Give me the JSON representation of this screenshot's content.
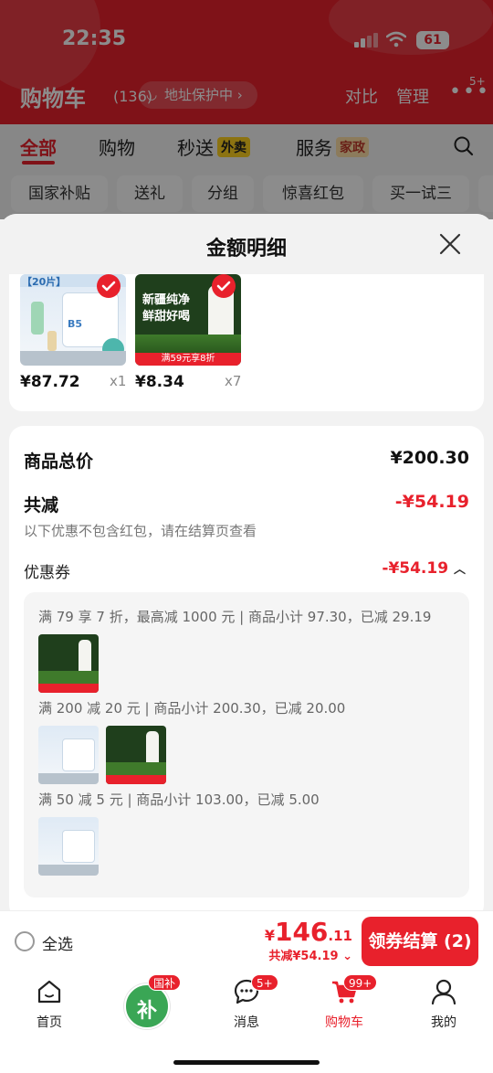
{
  "status_bar": {
    "time": "22:35",
    "battery": "61"
  },
  "cart_header": {
    "title": "购物车",
    "count": "(136)",
    "address_protect": "地址保护中",
    "compare": "对比",
    "manage": "管理",
    "more_badge": "5+"
  },
  "tabs": [
    {
      "label": "全部"
    },
    {
      "label": "购物"
    },
    {
      "label": "秒送",
      "tag": "外卖"
    },
    {
      "label": "服务",
      "tag": "家政"
    }
  ],
  "chips": [
    "国家补贴",
    "送礼",
    "分组",
    "惊喜红包",
    "买一试三"
  ],
  "sheet": {
    "title": "金额明细",
    "products": [
      {
        "price": "¥87.72",
        "qty": "x1",
        "thumb_label": "【20片】",
        "thumb_code": "B5"
      },
      {
        "price": "¥8.34",
        "qty": "x7",
        "thumb_line1": "新疆纯净",
        "thumb_line2": "鲜甜好喝",
        "thumb_promo": "满59元享8折"
      }
    ],
    "summary": {
      "total_label": "商品总价",
      "total_value": "¥200.30",
      "discount_label": "共减",
      "discount_value": "-¥54.19",
      "note": "以下优惠不包含红包，请在结算页查看",
      "coupon_label": "优惠券",
      "coupon_value": "-¥54.19"
    },
    "coupon_rules": [
      "满 79 享 7 折，最高减 1000 元 | 商品小计 97.30，已减 29.19",
      "满 200 减 20 元 | 商品小计 200.30，已减 20.00",
      "满 50 减 5 元 | 商品小计 103.00，已减 5.00"
    ]
  },
  "checkout": {
    "select_all": "全选",
    "yen": "¥",
    "total_int": "146",
    "total_dec": ".11",
    "saved": "共减¥54.19",
    "button": "领券结算 (2)"
  },
  "nav": [
    {
      "label": "首页"
    },
    {
      "label": "",
      "badge": "国补",
      "center_char": "补"
    },
    {
      "label": "消息",
      "badge": "5+"
    },
    {
      "label": "购物车",
      "badge": "99+"
    },
    {
      "label": "我的"
    }
  ],
  "colors": {
    "brand_red": "#e8212c",
    "milk_green": "#1f3f1c",
    "page_bg": "#f2f2f2"
  }
}
